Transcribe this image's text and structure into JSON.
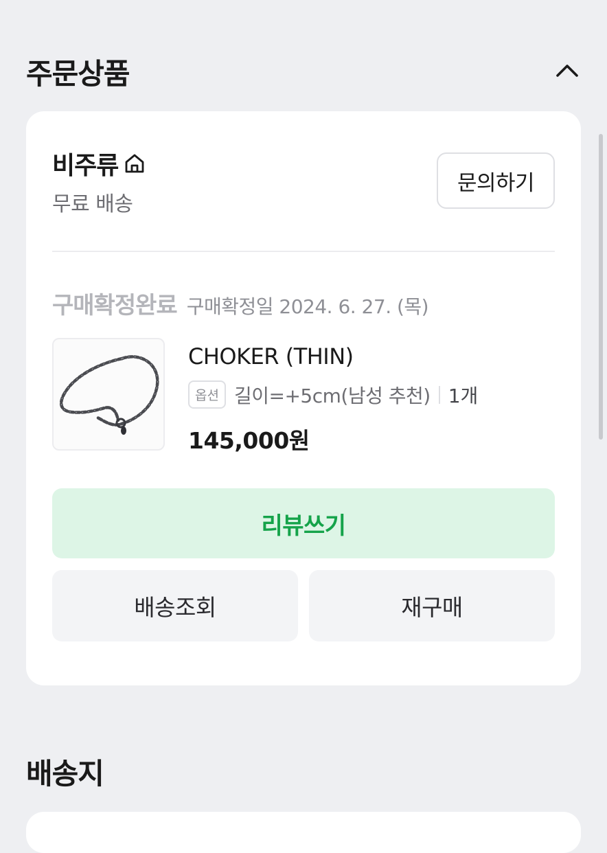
{
  "order_section": {
    "title": "주문상품",
    "collapse_icon": "chevron-up-icon"
  },
  "seller": {
    "name": "비주류",
    "home_icon": "home-icon",
    "shipping_fee": "무료 배송",
    "inquiry_label": "문의하기"
  },
  "status": {
    "label": "구매확정완료",
    "date": "구매확정일 2024. 6. 27. (목)"
  },
  "product": {
    "name": "CHOKER (THIN)",
    "option_badge": "옵션",
    "option_value": "길이=+5cm(남성 추천)",
    "quantity": "1개",
    "price": "145,000원"
  },
  "buttons": {
    "review": "리뷰쓰기",
    "track_delivery": "배송조회",
    "repurchase": "재구매"
  },
  "delivery_section": {
    "title": "배송지"
  },
  "colors": {
    "background": "#eeeff2",
    "card": "#ffffff",
    "review_bg": "#ddf5e6",
    "review_text": "#15a34a",
    "secondary_btn_bg": "#f3f4f6"
  }
}
